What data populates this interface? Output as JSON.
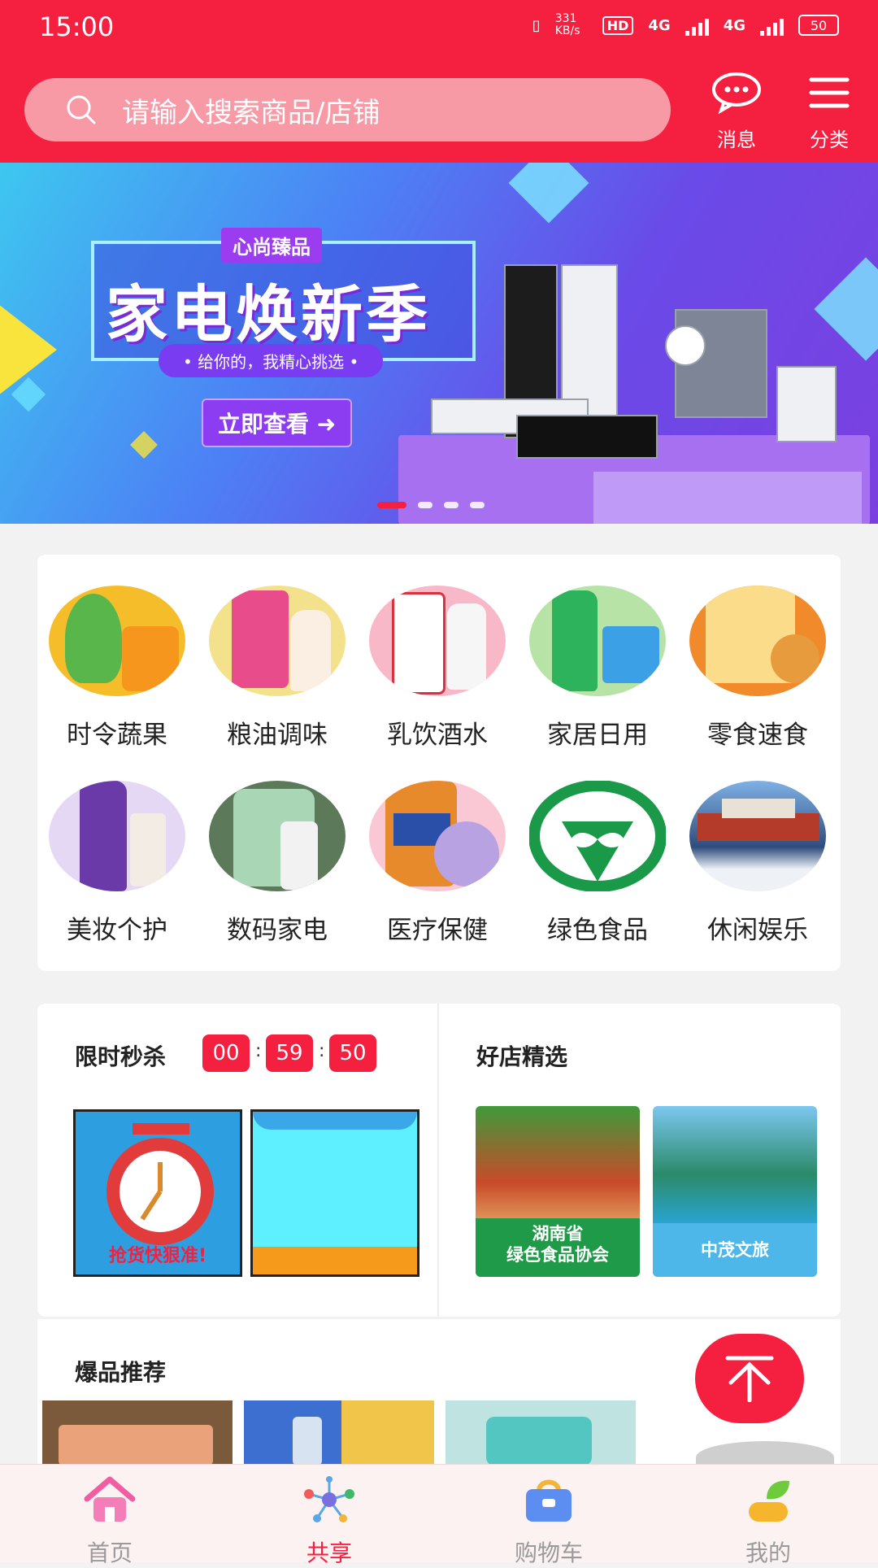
{
  "status_bar": {
    "time": "15:00",
    "net_speed": "331 KB/s",
    "hd": "HD",
    "net1": "4G",
    "net2": "4G",
    "battery": "50"
  },
  "header": {
    "search_placeholder": "请输入搜索商品/店铺",
    "messages_label": "消息",
    "category_label": "分类",
    "accent_color": "#f5203f"
  },
  "banner": {
    "tag": "心尚臻品",
    "title": "家电焕新季",
    "subtitle": "• 给你的，我精心挑选 •",
    "cta": "立即查看 ➜",
    "page_count": 4,
    "active_page": 1
  },
  "categories": [
    {
      "label": "时令蔬果",
      "icon": "fruit-veg-icon"
    },
    {
      "label": "粮油调味",
      "icon": "grain-oil-icon"
    },
    {
      "label": "乳饮酒水",
      "icon": "drinks-icon"
    },
    {
      "label": "家居日用",
      "icon": "household-icon"
    },
    {
      "label": "零食速食",
      "icon": "snack-icon"
    },
    {
      "label": "美妆个护",
      "icon": "cosmetics-icon"
    },
    {
      "label": "数码家电",
      "icon": "digital-icon"
    },
    {
      "label": "医疗保健",
      "icon": "healthcare-icon"
    },
    {
      "label": "绿色食品",
      "icon": "green-food-icon"
    },
    {
      "label": "休闲娱乐",
      "icon": "leisure-icon"
    }
  ],
  "flash_sale": {
    "title": "限时秒杀",
    "hours": "00",
    "minutes": "59",
    "seconds": "50",
    "item1_caption": "抢货快狠准!"
  },
  "good_shops": {
    "title": "好店精选",
    "shop1": "湖南省\n绿色食品协会",
    "shop1_line1": "湖南省",
    "shop1_line2": "绿色食品协会",
    "shop2": "中茂文旅"
  },
  "hot": {
    "title": "爆品推荐"
  },
  "bottom_nav": [
    {
      "label": "首页",
      "icon": "home-icon",
      "active": false
    },
    {
      "label": "共享",
      "icon": "share-icon",
      "active": true
    },
    {
      "label": "购物车",
      "icon": "cart-icon",
      "active": false
    },
    {
      "label": "我的",
      "icon": "profile-icon",
      "active": false
    }
  ]
}
